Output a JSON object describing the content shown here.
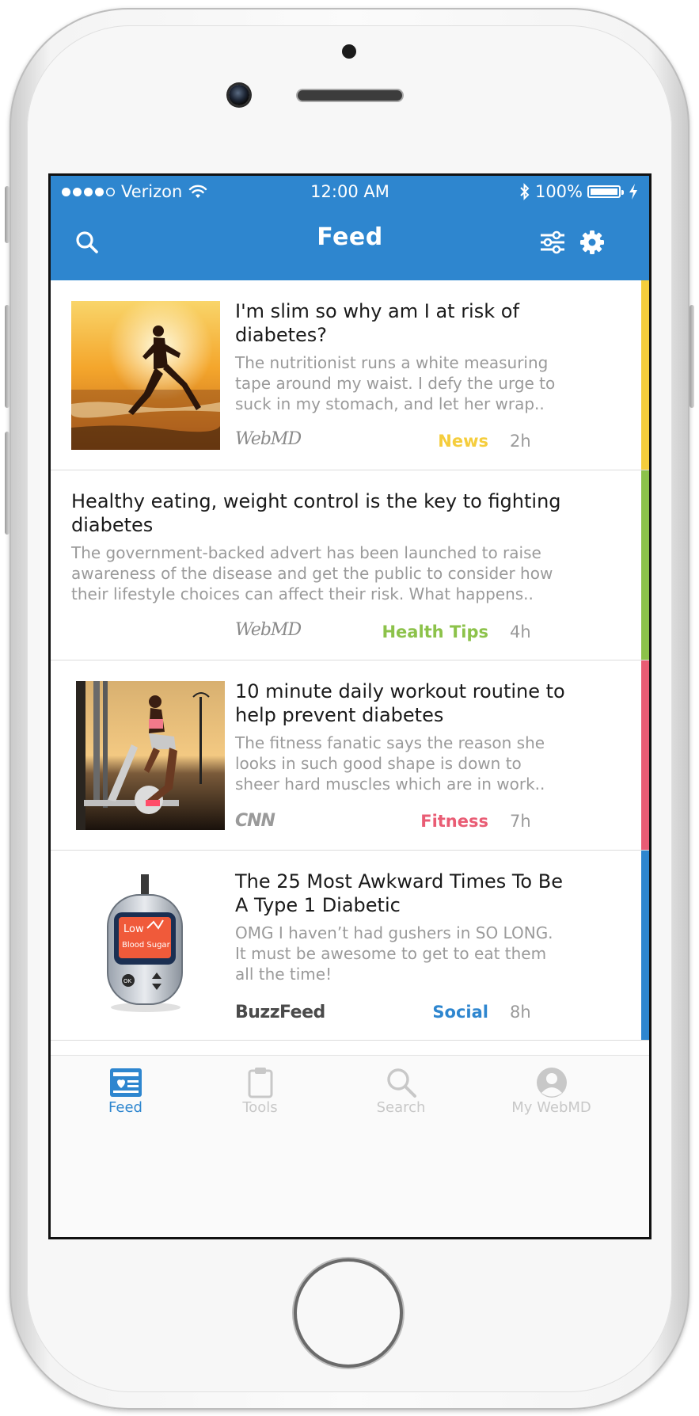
{
  "status_bar": {
    "carrier": "Verizon",
    "time": "12:00 AM",
    "battery": "100%"
  },
  "header": {
    "title": "Feed"
  },
  "feed": [
    {
      "title": "I'm slim so why am I at risk of diabetes?",
      "snippet": "The nutritionist runs a white measuring tape around my waist. I defy the urge to suck in my stomach, and let her wrap..",
      "source": "WebMD",
      "category": "News",
      "category_color": "#f5cd3c",
      "age": "2h"
    },
    {
      "title": "Healthy eating, weight control is the key to fighting diabetes",
      "snippet": "The government-backed advert has been launched to raise awareness of the disease and get the public to consider how their lifestyle choices can affect their risk. What happens..",
      "source": "WebMD",
      "category": "Health Tips",
      "category_color": "#8cc24a",
      "age": "4h"
    },
    {
      "title": "10 minute daily workout routine to help prevent diabetes",
      "snippet": "The fitness fanatic says the reason she looks in such good shape is down to sheer hard muscles which are in work..",
      "source": "CNN",
      "category": "Fitness",
      "category_color": "#e95c74",
      "age": "7h"
    },
    {
      "title": "The 25 Most Awkward Times To Be A Type 1 Diabetic",
      "snippet": "OMG I haven’t had gushers in SO LONG. It must be awesome to get to eat them all the time!",
      "source": "BuzzFeed",
      "category": "Social",
      "category_color": "#2e86cf",
      "age": "8h",
      "image_text_1": "Low",
      "image_text_2": "Blood Sugar",
      "image_button": "OK"
    }
  ],
  "tabs": [
    {
      "label": "Feed",
      "active": true
    },
    {
      "label": "Tools",
      "active": false
    },
    {
      "label": "Search",
      "active": false
    },
    {
      "label": "My WebMD",
      "active": false
    }
  ],
  "colors": {
    "brand_blue": "#2e86cf",
    "inactive_tab": "#c8c8c8",
    "news": "#f5cd3c",
    "health_tips": "#8cc24a",
    "fitness": "#e95c74",
    "social": "#2e86cf"
  },
  "icons": {
    "search": "search-icon",
    "filter": "filter-icon",
    "settings": "gear-icon"
  }
}
